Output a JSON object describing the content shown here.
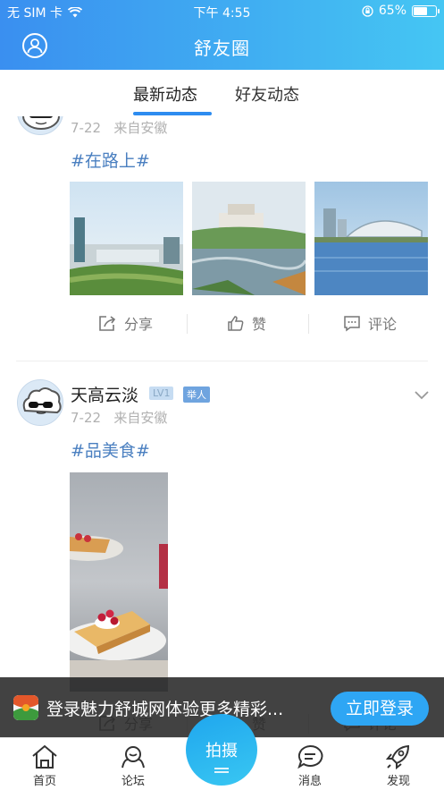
{
  "status_bar": {
    "carrier": "无 SIM 卡",
    "time": "下午 4:55",
    "battery": "65%",
    "battery_level": 0.65
  },
  "header": {
    "title": "舒友圈"
  },
  "tabs": [
    {
      "label": "最新动态",
      "active": true
    },
    {
      "label": "好友动态",
      "active": false
    }
  ],
  "posts": [
    {
      "date": "7-22",
      "location": "来自安徽",
      "topic": "#在路上#",
      "images": [
        "building-landscape",
        "park-lake",
        "stadium-waterfront"
      ],
      "actions": {
        "share": "分享",
        "like": "赞",
        "comment": "评论"
      }
    },
    {
      "username": "天高云淡",
      "level": "LV1",
      "role": "举人",
      "date": "7-22",
      "location": "来自安徽",
      "topic": "#品美食#",
      "images": [
        "dessert-cake"
      ],
      "actions": {
        "share": "分享",
        "like": "赞",
        "comment": "评论"
      }
    }
  ],
  "banner": {
    "text": "登录魅力舒城网体验更多精彩...",
    "button": "立即登录"
  },
  "tabbar": {
    "items": [
      {
        "label": "首页",
        "icon": "home-icon"
      },
      {
        "label": "论坛",
        "icon": "forum-icon"
      },
      {
        "label": "消息",
        "icon": "message-icon"
      },
      {
        "label": "发现",
        "icon": "rocket-icon"
      }
    ],
    "center": "拍摄"
  },
  "colors": {
    "accent": "#2d8cf0",
    "topic": "#4a7fc0",
    "header_start": "#3a8ff0",
    "header_end": "#45c6f3"
  }
}
